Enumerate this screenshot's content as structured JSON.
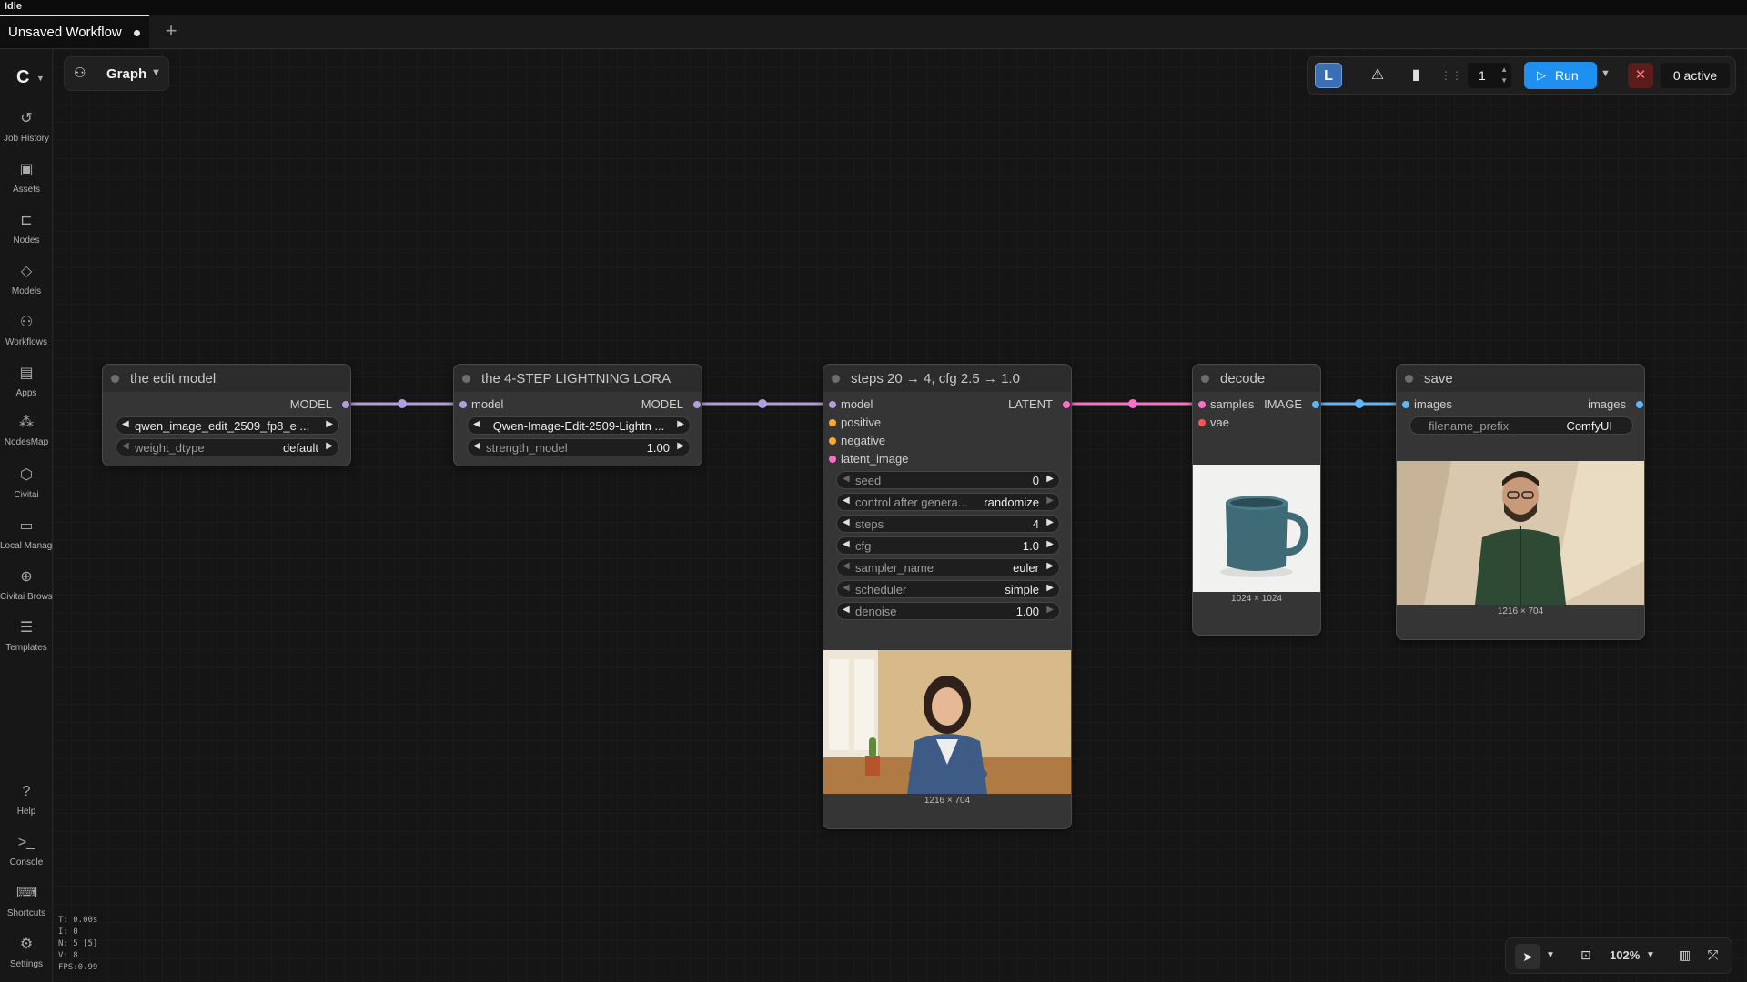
{
  "status": "Idle",
  "tab": {
    "title": "Unsaved Workflow"
  },
  "sidebar": {
    "items": [
      {
        "label": "Job History",
        "icon": "history-icon"
      },
      {
        "label": "Assets",
        "icon": "image-icon"
      },
      {
        "label": "Nodes",
        "icon": "node-icon"
      },
      {
        "label": "Models",
        "icon": "models-icon"
      },
      {
        "label": "Workflows",
        "icon": "workflow-icon"
      },
      {
        "label": "Apps",
        "icon": "apps-icon"
      },
      {
        "label": "NodesMap",
        "icon": "nodesmap-icon"
      },
      {
        "label": "Civitai",
        "icon": "civitai-icon"
      },
      {
        "label": "Local Manage",
        "icon": "folder-icon"
      },
      {
        "label": "Civitai Browse",
        "icon": "globe-icon"
      },
      {
        "label": "Templates",
        "icon": "templates-icon"
      }
    ],
    "bottom": [
      {
        "label": "Help",
        "icon": "help-icon"
      },
      {
        "label": "Console",
        "icon": "terminal-icon"
      },
      {
        "label": "Shortcuts",
        "icon": "keyboard-icon"
      },
      {
        "label": "Settings",
        "icon": "gear-icon"
      }
    ]
  },
  "toolbar": {
    "graph_label": "Graph"
  },
  "runbar": {
    "badge": "L",
    "count": "1",
    "run_label": "Run",
    "active_label": "0 active"
  },
  "nodes": {
    "edit_model": {
      "title": "the edit model",
      "output": "MODEL",
      "unet_name": "qwen_image_edit_2509_fp8_e  ...",
      "weight_dtype_name": "weight_dtype",
      "weight_dtype_value": "default"
    },
    "lora": {
      "title": "the 4-STEP LIGHTNING LORA",
      "input": "model",
      "output": "MODEL",
      "lora_name": "Qwen-Image-Edit-2509-Lightn ...",
      "strength_name": "strength_model",
      "strength_value": "1.00"
    },
    "sampler": {
      "title": "steps 20 → 4,  cfg 2.5 → 1.0",
      "inputs": [
        "model",
        "positive",
        "negative",
        "latent_image"
      ],
      "output": "LATENT",
      "widgets": [
        {
          "name": "seed",
          "value": "0"
        },
        {
          "name": "control after genera...",
          "value": "randomize"
        },
        {
          "name": "steps",
          "value": "4"
        },
        {
          "name": "cfg",
          "value": "1.0"
        },
        {
          "name": "sampler_name",
          "value": "euler"
        },
        {
          "name": "scheduler",
          "value": "simple"
        },
        {
          "name": "denoise",
          "value": "1.00"
        }
      ],
      "preview_dims": "1216 × 704"
    },
    "decode": {
      "title": "decode",
      "inputs": [
        "samples",
        "vae"
      ],
      "output": "IMAGE",
      "preview_dims": "1024 × 1024"
    },
    "save": {
      "title": "save",
      "input": "images",
      "output": "images",
      "prefix_name": "filename_prefix",
      "prefix_value": "ComfyUI",
      "preview_dims": "1216 × 704"
    }
  },
  "stats": [
    "T: 0.00s",
    "I: 0",
    "N: 5 [5]",
    "V: 8",
    "FPS:0.99"
  ],
  "bottombar": {
    "zoom": "102%"
  },
  "colors": {
    "model_wire": "#b39ddb",
    "latent_wire": "#ff6ec7",
    "image_wire": "#64b5f6",
    "conditioning_pin": "#ffa726",
    "vae_pin": "#ff5252",
    "run_button": "#1f8ff0"
  }
}
